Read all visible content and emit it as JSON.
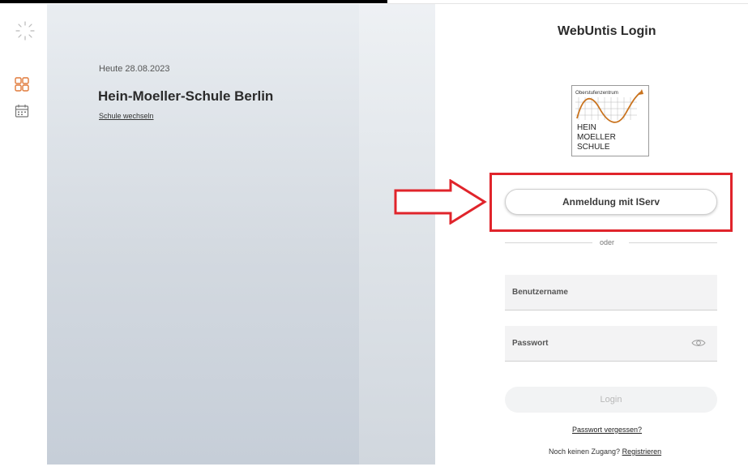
{
  "header": {
    "title": "WebUntis Login"
  },
  "sidebar": {
    "items": [
      {
        "icon": "dashboard-icon"
      },
      {
        "icon": "calendar-icon"
      }
    ]
  },
  "school": {
    "date_label": "Heute 28.08.2023",
    "name": "Hein-Moeller-Schule Berlin",
    "switch_link": "Schule wechseln"
  },
  "logo": {
    "line1": "Oberstufenzentrum",
    "line2": "HEIN",
    "line3": "MOELLER",
    "line4": "SCHULE"
  },
  "login": {
    "iserv_button": "Anmeldung mit IServ",
    "separator": "oder",
    "username_placeholder": "Benutzername",
    "password_placeholder": "Passwort",
    "submit": "Login",
    "forgot": "Passwort vergessen?",
    "no_access_text": "Noch keinen Zugang?",
    "register": "Registrieren"
  },
  "colors": {
    "accent_red": "#e0242b",
    "dashboard_icon": "#e07a3a",
    "logo_curve": "#c9731e"
  }
}
